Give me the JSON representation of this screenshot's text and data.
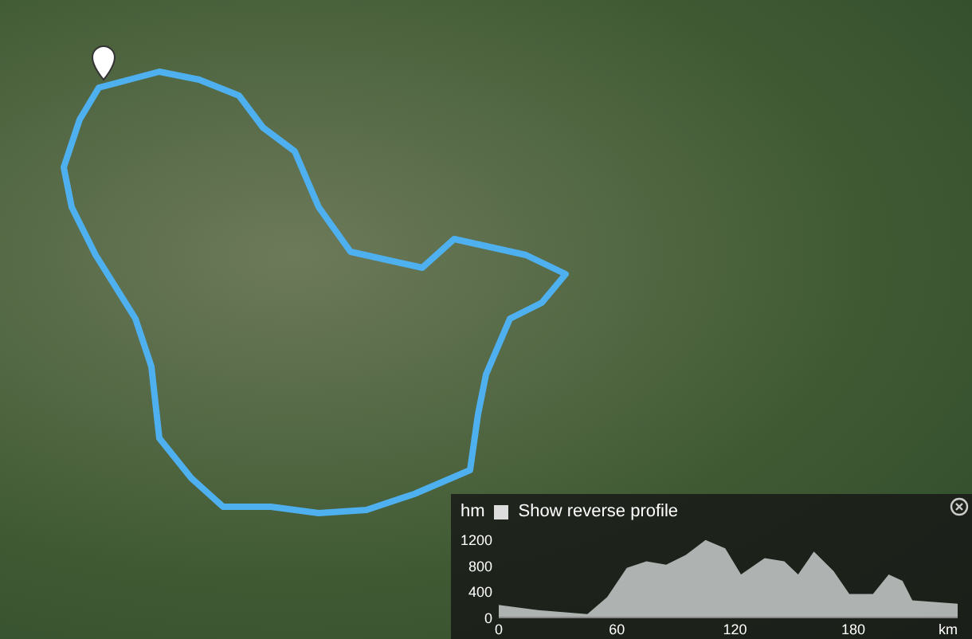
{
  "elevation_panel": {
    "unit_label": "hm",
    "reverse_toggle": {
      "label": "Show reverse profile",
      "checked": false
    },
    "chart_data": {
      "type": "area",
      "annotations": [
        {
          "text": "km"
        }
      ],
      "x": [
        0,
        20,
        45,
        55,
        65,
        75,
        85,
        95,
        105,
        115,
        123,
        135,
        145,
        152,
        160,
        170,
        178,
        190,
        198,
        205,
        210,
        233
      ],
      "series": [
        {
          "color": "#c8cccc",
          "values": [
            180,
            100,
            40,
            300,
            750,
            850,
            800,
            950,
            1180,
            1050,
            650,
            900,
            850,
            650,
            1000,
            700,
            350,
            350,
            650,
            550,
            250,
            200
          ]
        }
      ],
      "xlim": [
        0,
        233
      ],
      "ylim": [
        0,
        1200
      ],
      "xticks": [
        0,
        60,
        120,
        180
      ],
      "yticks": [
        0,
        400,
        800,
        1200
      ]
    }
  }
}
